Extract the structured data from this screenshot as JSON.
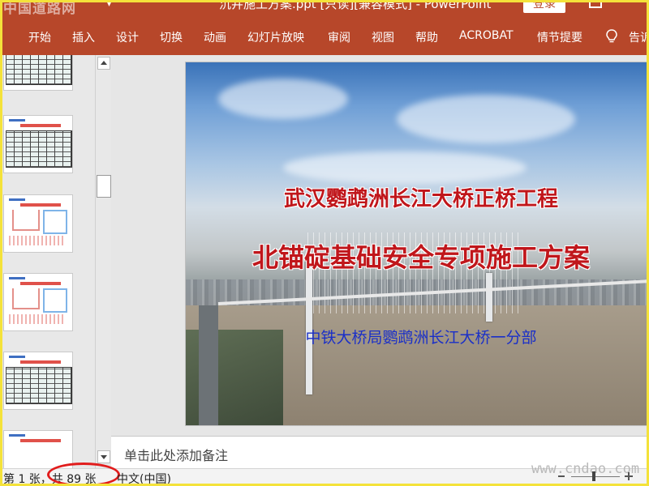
{
  "titlebar": {
    "logo_text": "中国道路网",
    "window_title": "沉井施工方案.ppt [只读][兼容模式] - PowerPoint",
    "login_label": "登录",
    "bg_color": "#b7472a"
  },
  "ribbon": {
    "tabs": [
      "开始",
      "插入",
      "设计",
      "切换",
      "动画",
      "幻灯片放映",
      "审阅",
      "视图",
      "帮助",
      "ACROBAT",
      "情节提要"
    ],
    "tell_me_label": "告诉"
  },
  "slide": {
    "title_line1": "武汉鹦鹉洲长江大桥正桥工程",
    "title_line2": "北锚碇基础安全专项施工方案",
    "subtitle": "中铁大桥局鹦鹉洲长江大桥一分部"
  },
  "notes": {
    "placeholder": "单击此处添加备注"
  },
  "statusbar": {
    "slide_counter": "第 1 张，共 89 张",
    "language": "中文(中国)",
    "watermark": "www.cndao.com"
  },
  "icons": [
    "dropdown-arrow-icon",
    "ribbon-display-icon",
    "lightbulb-icon",
    "scroll-up-icon",
    "scroll-down-icon",
    "zoom-minus-icon",
    "zoom-plus-icon"
  ]
}
